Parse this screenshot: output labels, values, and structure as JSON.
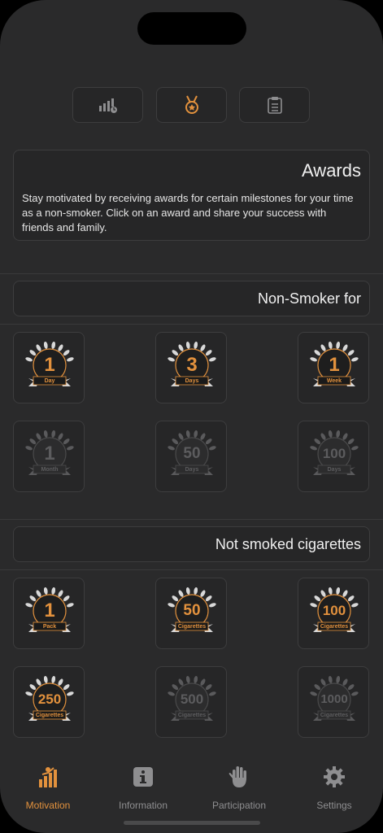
{
  "header": {
    "title": "Awards",
    "description": "Stay motivated by receiving awards for certain milestones for your time as a non-smoker. Click on an award and share your success with friends and family."
  },
  "segments": [
    {
      "name": "statistics-icon",
      "active": false
    },
    {
      "name": "medal-icon",
      "active": true
    },
    {
      "name": "clipboard-icon",
      "active": false
    }
  ],
  "sections": [
    {
      "title": "Non-Smoker for",
      "awards": [
        {
          "num": "1",
          "label": "Day",
          "earned": true
        },
        {
          "num": "3",
          "label": "Days",
          "earned": true
        },
        {
          "num": "1",
          "label": "Week",
          "earned": true
        },
        {
          "num": "1",
          "label": "Month",
          "earned": false
        },
        {
          "num": "50",
          "label": "Days",
          "earned": false
        },
        {
          "num": "100",
          "label": "Days",
          "earned": false
        }
      ]
    },
    {
      "title": "Not smoked cigarettes",
      "awards": [
        {
          "num": "1",
          "label": "Pack",
          "earned": true
        },
        {
          "num": "50",
          "label": "Cigarettes",
          "earned": true
        },
        {
          "num": "100",
          "label": "Cigarettes",
          "earned": true
        },
        {
          "num": "250",
          "label": "Cigarettes",
          "earned": true
        },
        {
          "num": "500",
          "label": "Cigarettes",
          "earned": false
        },
        {
          "num": "1000",
          "label": "Cigarettes",
          "earned": false
        }
      ]
    }
  ],
  "tabs": [
    {
      "label": "Motivation",
      "icon": "motivation-icon",
      "active": true
    },
    {
      "label": "Information",
      "icon": "info-icon",
      "active": false
    },
    {
      "label": "Participation",
      "icon": "hand-icon",
      "active": false
    },
    {
      "label": "Settings",
      "icon": "gear-icon",
      "active": false
    }
  ],
  "colors": {
    "accent": "#e2913d",
    "earned_ring": "#2a2a2a",
    "inactive": "#8e8e90",
    "locked": "#5a5a5c"
  }
}
